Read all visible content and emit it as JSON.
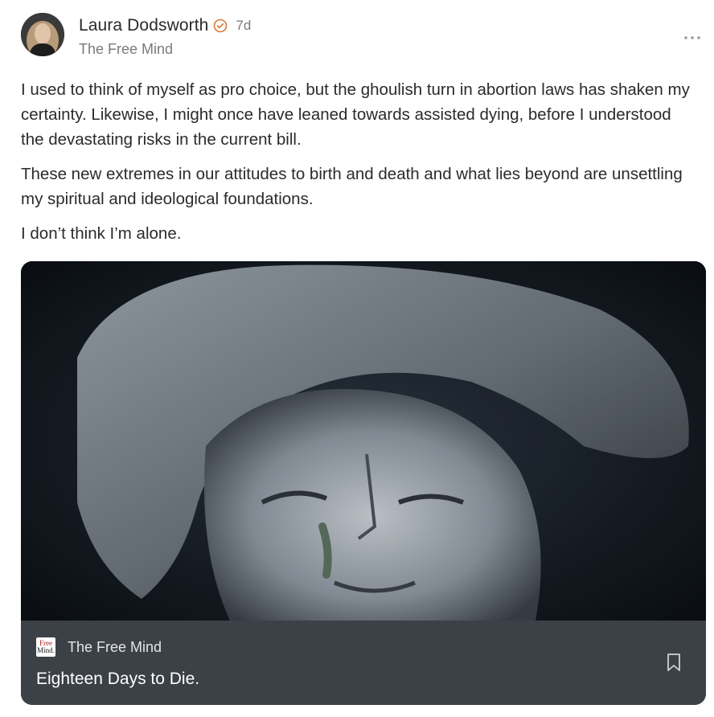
{
  "post": {
    "author": "Laura Dodsworth",
    "time_ago": "7d",
    "publication": "The Free Mind",
    "paragraphs": [
      "I used to think of myself as pro choice, but the ghoulish turn in abortion laws has shaken my certainty. Likewise, I might once have leaned towards assisted dying, before I understood the devastating risks in the current bill.",
      "These new extremes in our attitudes to birth and death and what lies beyond are unsettling my spiritual and ideological foundations.",
      "I don’t think I’m alone."
    ]
  },
  "card": {
    "publication": "The Free Mind",
    "logo_line1": "Free",
    "logo_line2": "Mind.",
    "title": "Eighteen Days to Die."
  },
  "icons": {
    "verified": "verified-check-icon",
    "more": "more-horizontal-icon",
    "bookmark": "bookmark-icon"
  },
  "colors": {
    "card_footer": "#3b4147",
    "verified": "#d87a3a",
    "muted_text": "#7a7a7a"
  }
}
